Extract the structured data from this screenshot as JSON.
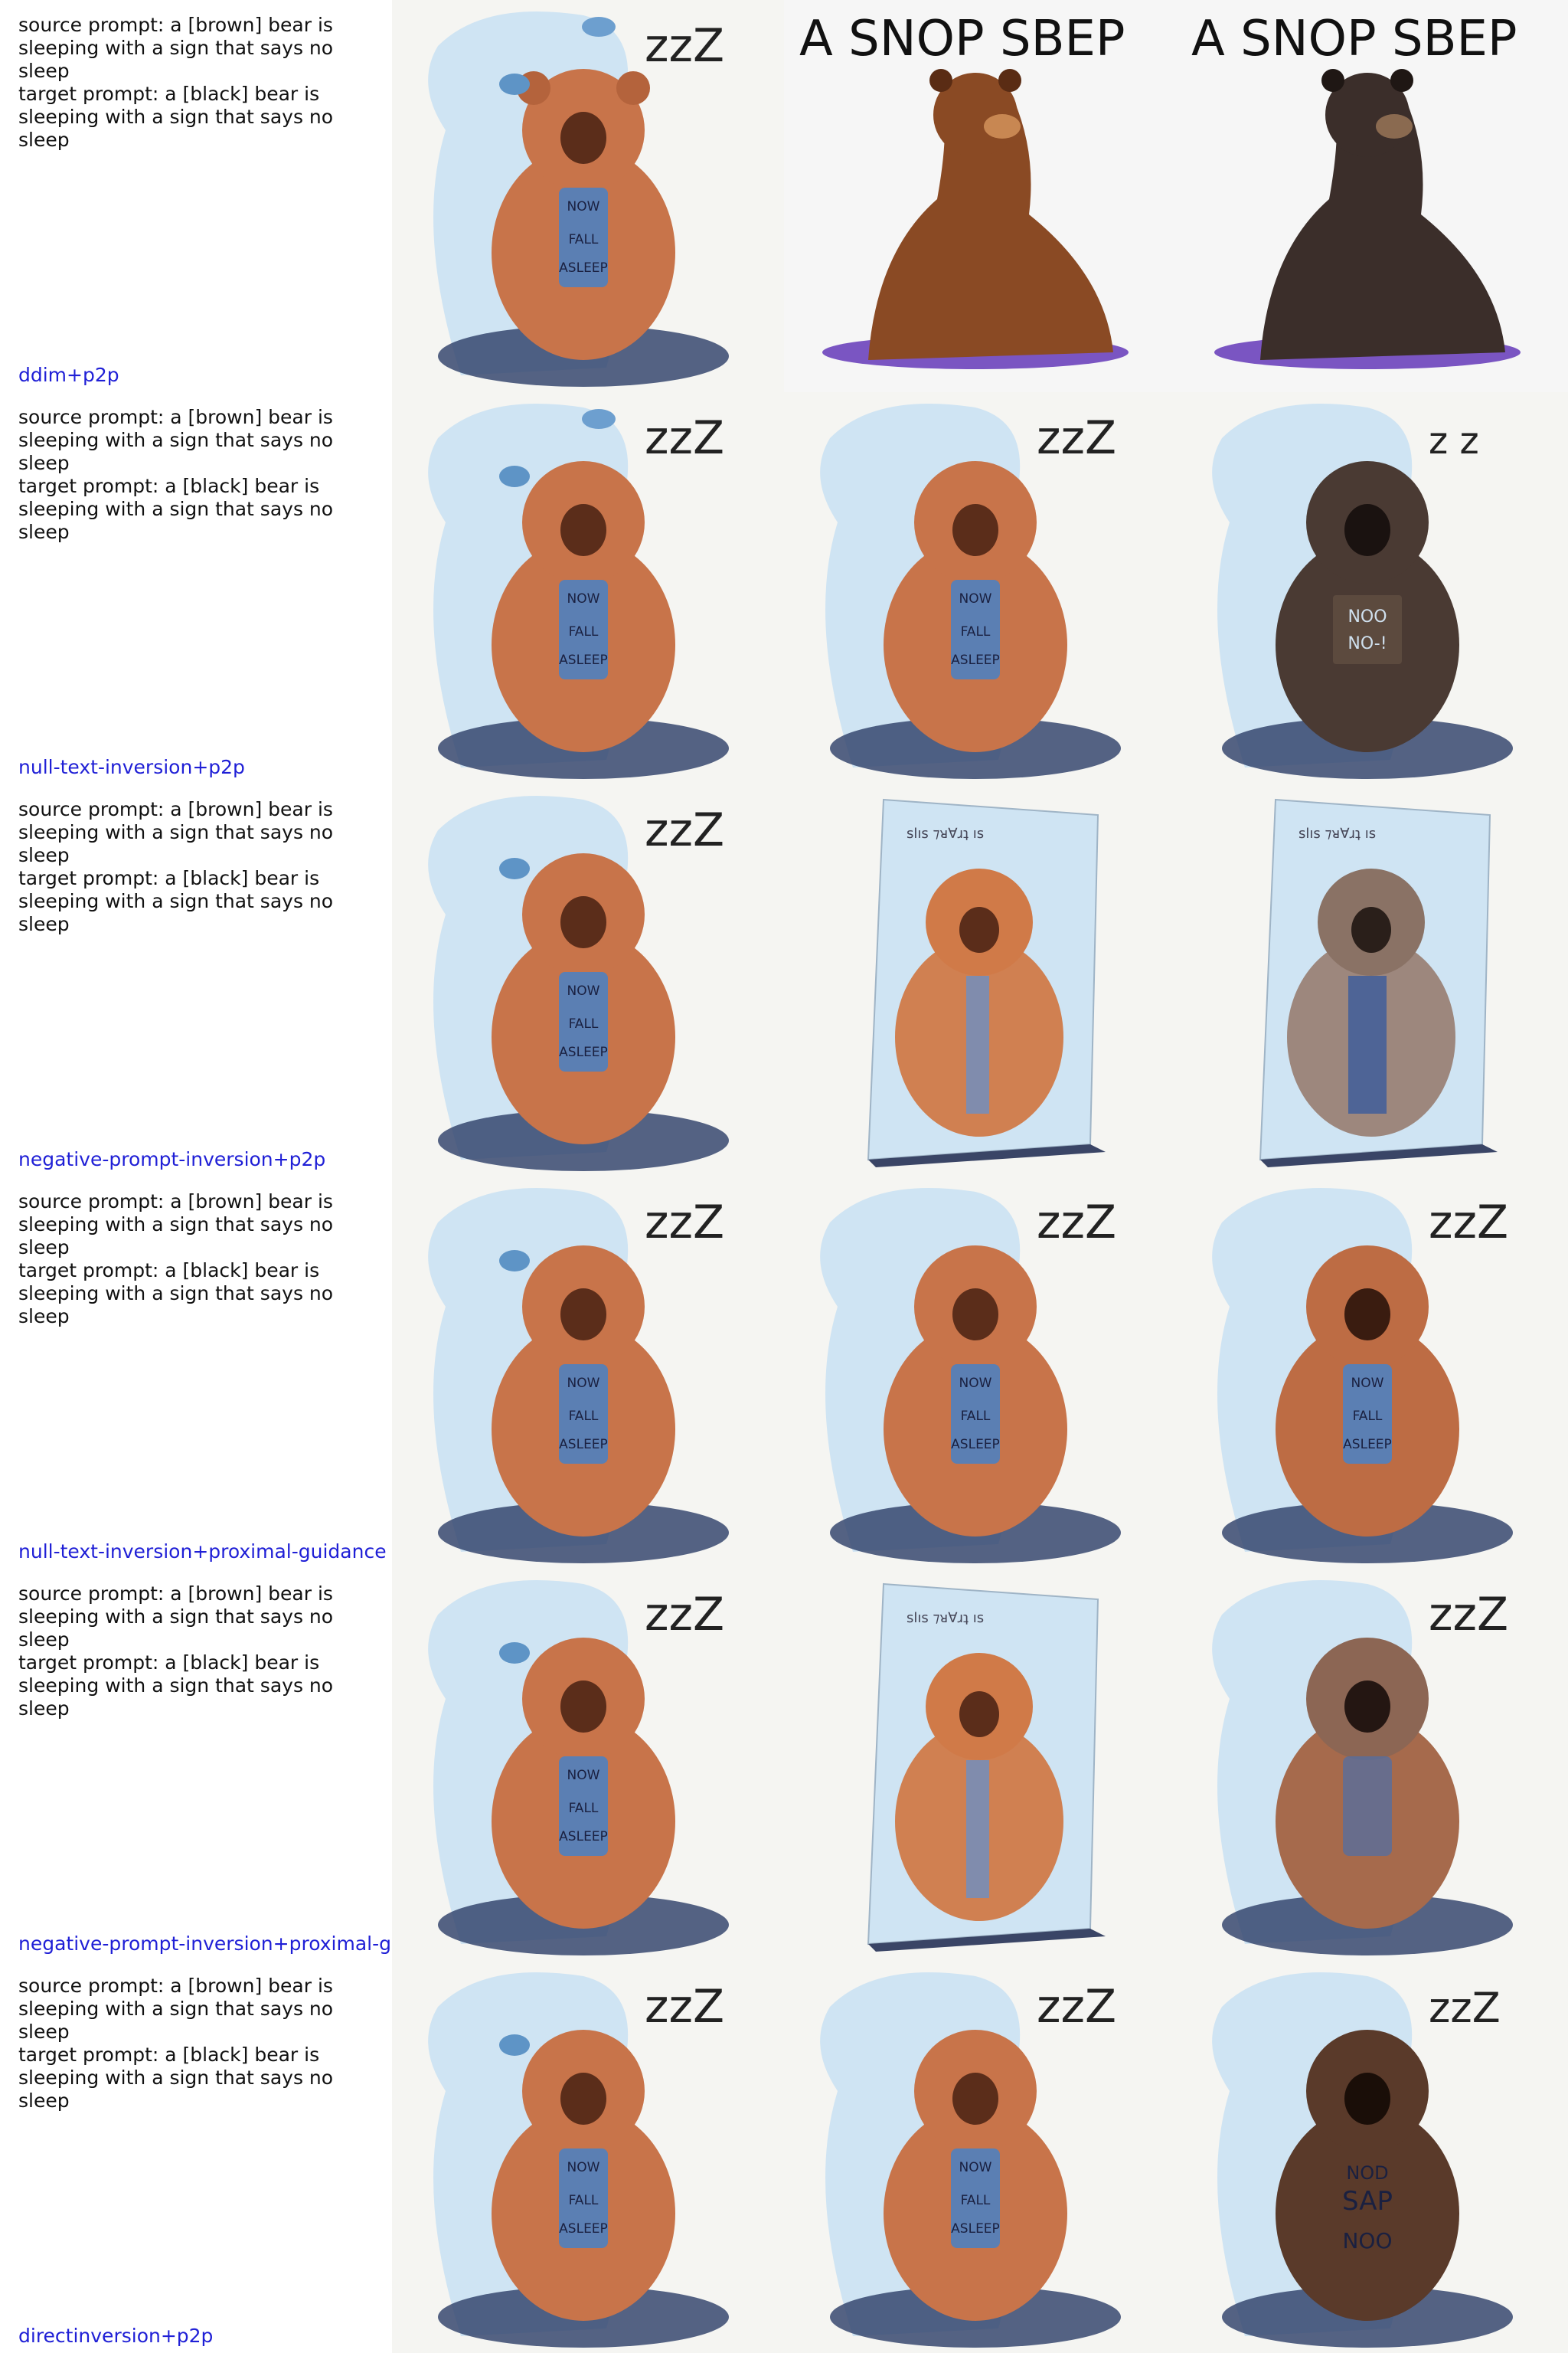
{
  "rows": [
    {
      "prompt": "source prompt: a [brown] bear is sleeping with a sign that says no sleep\ntarget prompt: a [black] bear is sleeping with a sign that says no sleep",
      "method": "ddim+p2p"
    },
    {
      "prompt": "source prompt: a [brown] bear is sleeping with a sign that says no sleep\ntarget prompt: a [black] bear is sleeping with a sign that says no sleep",
      "method": "null-text-inversion+p2p"
    },
    {
      "prompt": "source prompt: a [brown] bear is sleeping with a sign that says no sleep\ntarget prompt: a [black] bear is sleeping with a sign that says no sleep",
      "method": "negative-prompt-inversion+p2p"
    },
    {
      "prompt": "source prompt: a [brown] bear is sleeping with a sign that says no sleep\ntarget prompt: a [black] bear is sleeping with a sign that says no sleep",
      "method": "null-text-inversion+proximal-guidance"
    },
    {
      "prompt": "source prompt: a [brown] bear is sleeping with a sign that says no sleep\ntarget prompt: a [black] bear is sleeping with a sign that says no sleep",
      "method": "negative-prompt-inversion+proximal-g"
    },
    {
      "prompt": "source prompt: a [brown] bear is sleeping with a sign that says no sleep\ntarget prompt: a [black] bear is sleeping with a sign that says no sleep",
      "method": "directinversion+p2p"
    }
  ],
  "sign_text": {
    "source": "NOW\nFALL\nASLEEP",
    "r1_banner": "A SNOP SBEP",
    "r2_target": "NOO\nNO-!",
    "r6_target_a": "NOD\nSAP",
    "r6_target_b": "NOO",
    "canvas_caption": "slıs ⁊ᴚ∀ɹʇ ıs"
  },
  "colors": {
    "label_method": "#1f1fd6",
    "bear_brown": "#c8744a",
    "bear_black": "#3b2e2a",
    "watercolor": "#cfe4f3",
    "sign_blue": "#5b7fb3"
  },
  "icons": [
    "zzz-icon",
    "cloud-icon",
    "bird-icon"
  ]
}
